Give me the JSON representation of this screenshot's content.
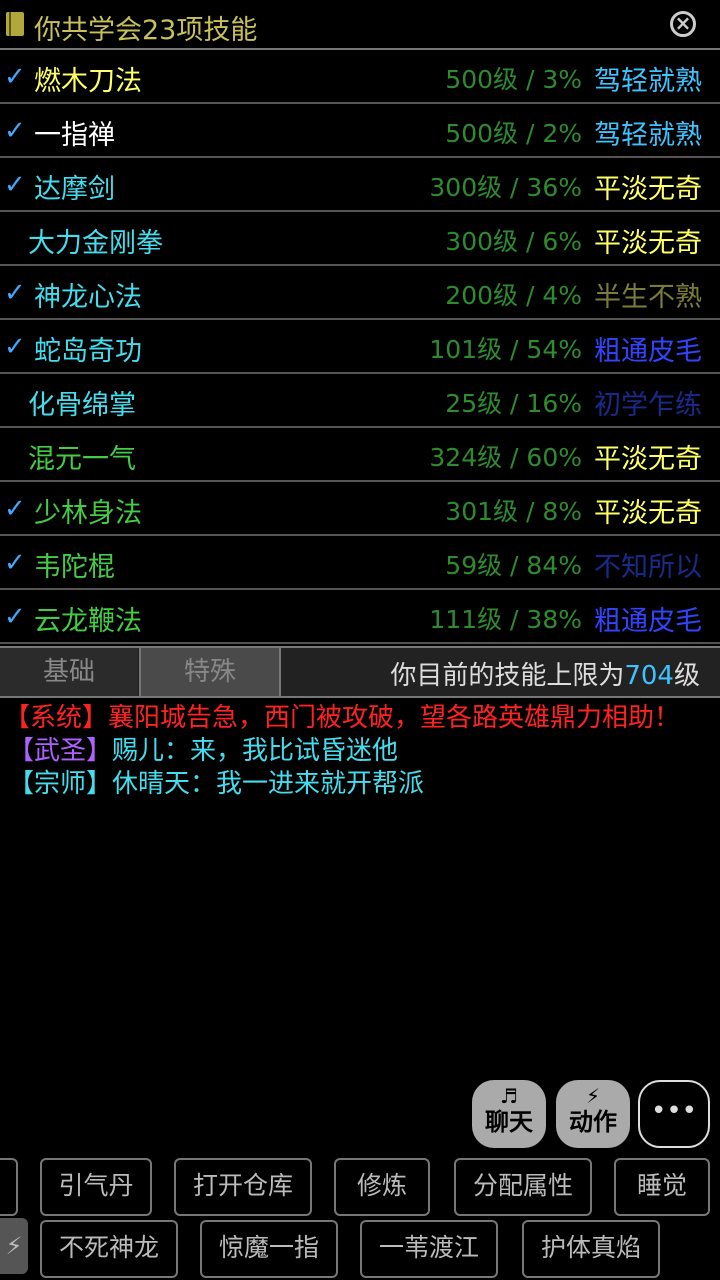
{
  "title": "你共学会23项技能",
  "colors": {
    "accent": "#3fa8ff",
    "yellow": "#ffff66",
    "green": "#44cc44",
    "cyan": "#44ddee",
    "blue": "#3366ff",
    "red": "#ff2222",
    "purple": "#b060ff"
  },
  "skills": [
    {
      "name": "燃木刀法",
      "level": "500级 / 3%",
      "rank": "驾轻就熟",
      "checked": true,
      "name_color": "#ffff66",
      "rank_color": "#3ec3ff"
    },
    {
      "name": "一指禅",
      "level": "500级 / 2%",
      "rank": "驾轻就熟",
      "checked": true,
      "name_color": "#ffffff",
      "rank_color": "#3ec3ff"
    },
    {
      "name": "达摩剑",
      "level": "300级 / 36%",
      "rank": "平淡无奇",
      "checked": true,
      "name_color": "#44ddee",
      "rank_color": "#ffff66"
    },
    {
      "name": "大力金刚拳",
      "level": "300级 / 6%",
      "rank": "平淡无奇",
      "checked": false,
      "name_color": "#44ddee",
      "rank_color": "#ffff66"
    },
    {
      "name": "神龙心法",
      "level": "200级 / 4%",
      "rank": "半生不熟",
      "checked": true,
      "name_color": "#44ddee",
      "rank_color": "#7c7c3a"
    },
    {
      "name": "蛇岛奇功",
      "level": "101级 / 54%",
      "rank": "粗通皮毛",
      "checked": true,
      "name_color": "#44ddee",
      "rank_color": "#3344ff"
    },
    {
      "name": "化骨绵掌",
      "level": "25级 / 16%",
      "rank": "初学乍练",
      "checked": false,
      "name_color": "#44ddee",
      "rank_color": "#1a2a8a"
    },
    {
      "name": "混元一气",
      "level": "324级 / 60%",
      "rank": "平淡无奇",
      "checked": false,
      "name_color": "#44cc44",
      "rank_color": "#ffff66"
    },
    {
      "name": "少林身法",
      "level": "301级 / 8%",
      "rank": "平淡无奇",
      "checked": true,
      "name_color": "#44cc44",
      "rank_color": "#ffff66"
    },
    {
      "name": "韦陀棍",
      "level": "59级 / 84%",
      "rank": "不知所以",
      "checked": true,
      "name_color": "#44cc44",
      "rank_color": "#1a2a8a"
    },
    {
      "name": "云龙鞭法",
      "level": "111级 / 38%",
      "rank": "粗通皮毛",
      "checked": true,
      "name_color": "#44cc44",
      "rank_color": "#3344ff"
    }
  ],
  "tabs": {
    "basic": "基础",
    "special": "特殊"
  },
  "limit": {
    "prefix": "你目前的技能上限为",
    "value": "704",
    "suffix": "级"
  },
  "chat": [
    {
      "tag": "【系统】",
      "tag_color": "#ff2222",
      "text": "襄阳城告急，西门被攻破，望各路英雄鼎力相助！",
      "text_color": "#ff2222"
    },
    {
      "tag": "【武圣】",
      "tag_color": "#b060ff",
      "text": "赐儿：来，我比试昏迷他",
      "text_color": "#44ddee"
    },
    {
      "tag": "【宗师】",
      "tag_color": "#44ddee",
      "text": "休晴天：我一进来就开帮派",
      "text_color": "#44ddee"
    }
  ],
  "controls": {
    "chat_label": "聊天",
    "action_label": "动作",
    "more_label": "•••"
  },
  "buttons_row1": [
    "引气丹",
    "打开仓库",
    "修炼",
    "分配属性",
    "睡觉"
  ],
  "buttons_row2": [
    "不死神龙",
    "惊魔一指",
    "一苇渡江",
    "护体真焰"
  ]
}
